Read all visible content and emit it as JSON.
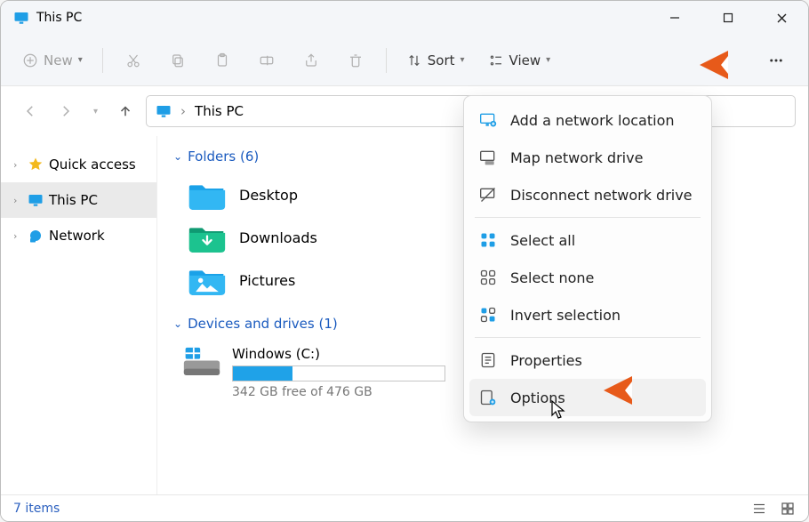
{
  "titlebar": {
    "title": "This PC"
  },
  "toolbar": {
    "new_label": "New",
    "sort_label": "Sort",
    "view_label": "View"
  },
  "address": {
    "location": "This PC"
  },
  "nav": {
    "items": [
      {
        "label": "Quick access"
      },
      {
        "label": "This PC"
      },
      {
        "label": "Network"
      }
    ]
  },
  "groups": {
    "folders_header": "Folders (6)",
    "drives_header": "Devices and drives (1)"
  },
  "folders": [
    {
      "label": "Desktop"
    },
    {
      "label": "Downloads"
    },
    {
      "label": "Pictures"
    }
  ],
  "drive": {
    "label": "Windows (C:)",
    "free_text": "342 GB free of 476 GB",
    "used_pct": 28
  },
  "context_menu": {
    "items": [
      {
        "label": "Add a network location"
      },
      {
        "label": "Map network drive"
      },
      {
        "label": "Disconnect network drive"
      },
      {
        "label": "Select all"
      },
      {
        "label": "Select none"
      },
      {
        "label": "Invert selection"
      },
      {
        "label": "Properties"
      },
      {
        "label": "Options"
      }
    ]
  },
  "statusbar": {
    "count_text": "7 items"
  }
}
